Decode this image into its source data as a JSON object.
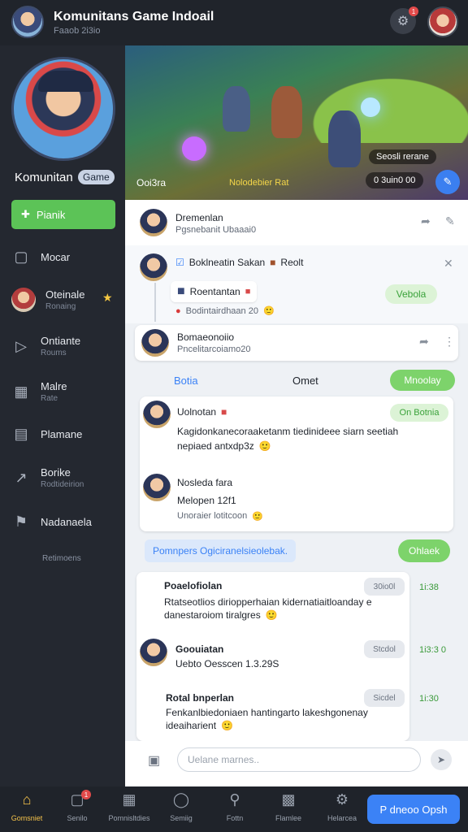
{
  "header": {
    "title": "Komunitans Game Indoail",
    "subtitle": "Faaob 2i3io",
    "notification_count": "1",
    "icons": {
      "bell": "bell-icon",
      "user": "user-avatar"
    }
  },
  "sidebar": {
    "profile_name": "Komunitan",
    "profile_tag": "Game",
    "join_label": "Pianik",
    "items": [
      {
        "label": "Mocar",
        "sub": "",
        "icon": "chat-icon"
      },
      {
        "label": "Oteinale",
        "sub": "Ronaing",
        "icon": "avatar"
      },
      {
        "label": "Ontiante",
        "sub": "Roums",
        "icon": "megaphone-icon"
      },
      {
        "label": "Malre",
        "sub": "Rate",
        "icon": "calendar-icon"
      },
      {
        "label": "Plamane",
        "sub": "",
        "icon": "board-icon"
      },
      {
        "label": "Borike",
        "sub": "Rodtideirion",
        "icon": "chart-icon"
      },
      {
        "label": "Nadanaela",
        "sub": "",
        "icon": "flag-icon"
      }
    ],
    "footer": "Retimoens"
  },
  "banner": {
    "title": "Ooi3ra",
    "tag": "Nolodebier Rat",
    "stat": "Seosli rerane",
    "count": "0 3uin0 00"
  },
  "feed": {
    "post1": {
      "name": "Dremenlan",
      "meta": "Pgsnebanit Ubaaai0"
    },
    "post2": {
      "name": "Boklneatin Sakan",
      "extra": "Reolt",
      "reply_name": "Roentantan",
      "reply_meta": "Bodintairdhaan 20",
      "pill": "Vebola"
    },
    "post3": {
      "name": "Bomaeonoiio",
      "meta": "Pncelitarcoiamo20"
    }
  },
  "thread": {
    "tab_left": "Botia",
    "tab_mid": "Omet",
    "tab_right": "Mnoolay",
    "m1": {
      "name": "Uolnotan",
      "pill": "On Botnia",
      "text": "Kagidonkanecoraaketanm tiedinideee siarn seetiah",
      "text2": "nepiaed antxdp3z"
    },
    "m2": {
      "name": "Nosleda fara",
      "line": "Melopen 12f1",
      "meta": "Unoraier lotitcoon"
    }
  },
  "banner2": {
    "text": "Pomnpers Ogiciranelsieolebak.",
    "btn": "Ohlaek"
  },
  "messages": [
    {
      "name": "Poaelofiolan",
      "chip": "30io0l",
      "time": "1i:38",
      "text": "Rtatseotlios diriopperhaian kidernatiaitloanday e",
      "text2": "danestaroiom tiralgres"
    },
    {
      "name": "Goouiatan",
      "chip": "Stcdol",
      "time": "1i3:3 0",
      "text": "Uebto Oesscen 1.3.29S"
    },
    {
      "name": "Rotal bnperlan",
      "chip": "Sicdel",
      "time": "1i:30",
      "text": "Fenkanlbiedoniaen hantingarto lakeshgonenay",
      "text2": "ideaiharient"
    }
  ],
  "composer": {
    "placeholder": "Uelane marnes.."
  },
  "bottomnav": {
    "items": [
      {
        "label": "Gomsniet",
        "icon": "home-icon",
        "active": true
      },
      {
        "label": "Senilo",
        "icon": "chat-icon",
        "badge": "1"
      },
      {
        "label": "Pomnisltdies",
        "icon": "image-icon"
      },
      {
        "label": "Semiig",
        "icon": "comment-icon"
      },
      {
        "label": "Fottn",
        "icon": "search-icon"
      },
      {
        "label": "Flamlee",
        "icon": "grid-icon"
      },
      {
        "label": "Helarcea",
        "icon": "settings-icon"
      }
    ],
    "cta": "P dneoo Opsh"
  },
  "colors": {
    "accent_green": "#5cc357",
    "accent_blue": "#3b82f6",
    "sidebar_bg": "#242830",
    "main_bg": "#eef1f5"
  }
}
